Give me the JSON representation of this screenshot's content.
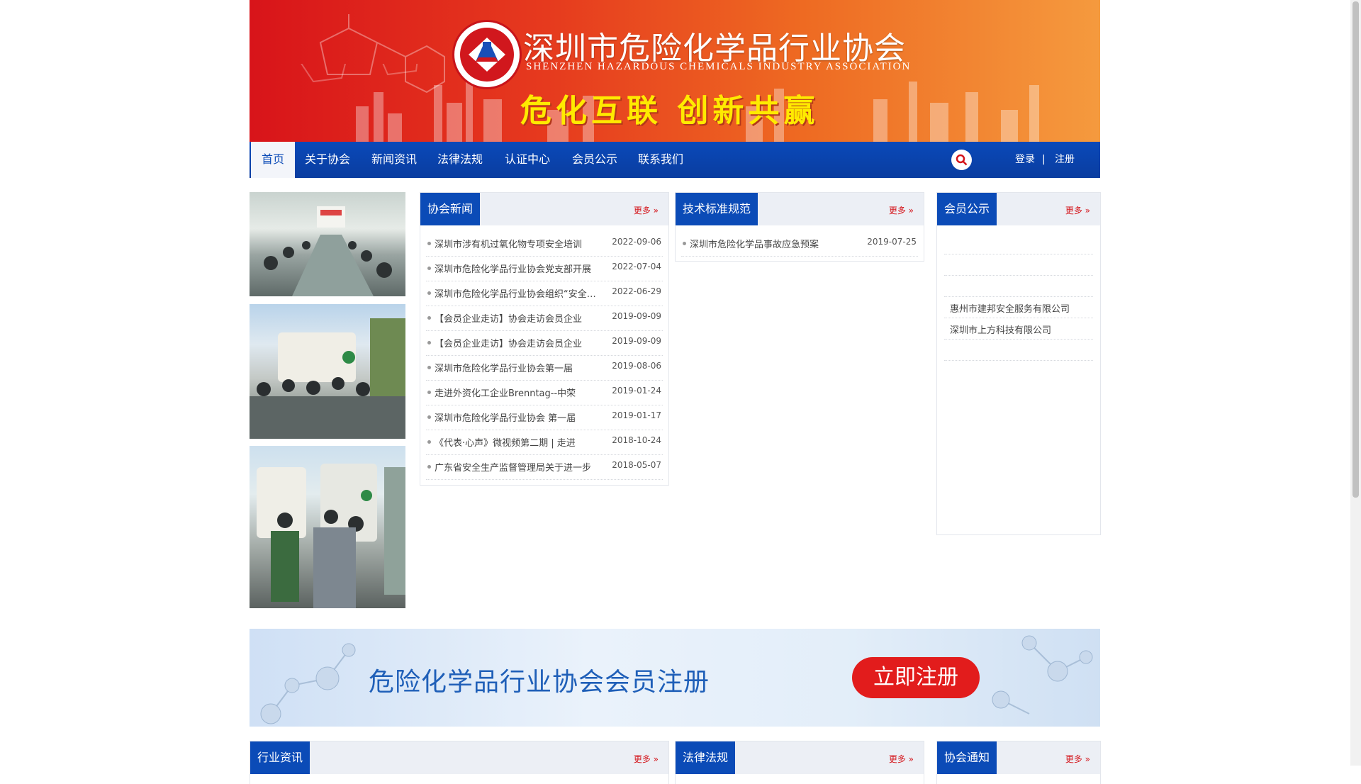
{
  "banner": {
    "title_cn": "深圳市危险化学品行业协会",
    "title_en": "SHENZHEN HAZARDOUS CHEMICALS INDUSTRY ASSOCIATION",
    "slogan": "危化互联 创新共赢"
  },
  "nav": {
    "items": [
      "首页",
      "关于协会",
      "新闻资讯",
      "法律法规",
      "认证中心",
      "会员公示",
      "联系我们"
    ],
    "active": "首页",
    "login": "登录",
    "separator": "|",
    "register": "注册"
  },
  "panels": {
    "association_news": {
      "title": "协会新闻",
      "more": "更多",
      "items": [
        {
          "title": "深圳市涉有机过氧化物专项安全培训",
          "date": "2022-09-06"
        },
        {
          "title": "深圳市危险化学品行业协会党支部开展",
          "date": "2022-07-04"
        },
        {
          "title": "深圳市危险化学品行业协会组织“安全生产月”",
          "date": "2022-06-29"
        },
        {
          "title": "【会员企业走访】协会走访会员企业",
          "date": "2019-09-09"
        },
        {
          "title": "【会员企业走访】协会走访会员企业",
          "date": "2019-09-09"
        },
        {
          "title": "深圳市危险化学品行业协会第一届",
          "date": "2019-08-06"
        },
        {
          "title": "走进外资化工企业Brenntag--中荣",
          "date": "2019-01-24"
        },
        {
          "title": "深圳市危险化学品行业协会 第一届",
          "date": "2019-01-17"
        },
        {
          "title": "《代表·心声》微视频第二期 | 走进",
          "date": "2018-10-24"
        },
        {
          "title": "广东省安全生产监督管理局关于进一步",
          "date": "2018-05-07"
        }
      ]
    },
    "tech_standards": {
      "title": "技术标准规范",
      "more": "更多",
      "items": [
        {
          "title": "深圳市危险化学品事故应急预案",
          "date": "2019-07-25"
        }
      ]
    },
    "member_public": {
      "title": "会员公示",
      "more": "更多",
      "items": [
        "",
        "",
        "",
        "惠州市建邦安全服务有限公司",
        "深圳市上方科技有限公司",
        ""
      ]
    }
  },
  "register_banner": {
    "text": "危险化学品行业协会会员注册",
    "button": "立即注册"
  },
  "bottom_panels": [
    {
      "title": "行业资讯",
      "more": "更多"
    },
    {
      "title": "法律法规",
      "more": "更多"
    },
    {
      "title": "协会通知",
      "more": "更多"
    }
  ]
}
